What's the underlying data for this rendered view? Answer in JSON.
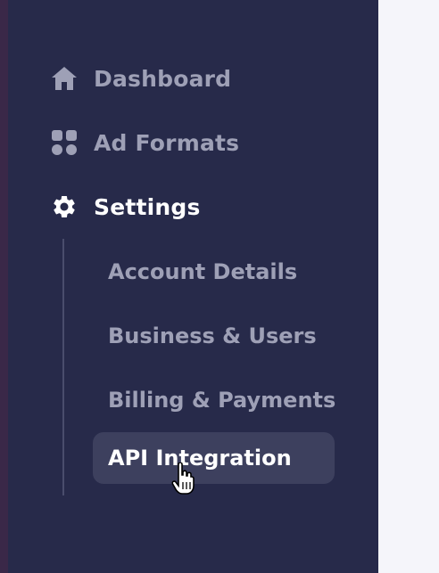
{
  "sidebar": {
    "nav": [
      {
        "label": "Dashboard",
        "icon": "home-icon",
        "active": false
      },
      {
        "label": "Ad Formats",
        "icon": "grid-icon",
        "active": false
      },
      {
        "label": "Settings",
        "icon": "gear-icon",
        "active": true
      }
    ],
    "settings_sub": [
      {
        "label": "Account Details",
        "active": false
      },
      {
        "label": "Business & Users",
        "active": false
      },
      {
        "label": "Billing & Payments",
        "active": false
      },
      {
        "label": "API Integration",
        "active": true
      }
    ]
  },
  "colors": {
    "sidebar_bg": "#272a4a",
    "inactive_text": "#9ea0b6",
    "active_text": "#ffffff",
    "active_bg": "#3d405e",
    "content_bg": "#f5f5fa"
  }
}
